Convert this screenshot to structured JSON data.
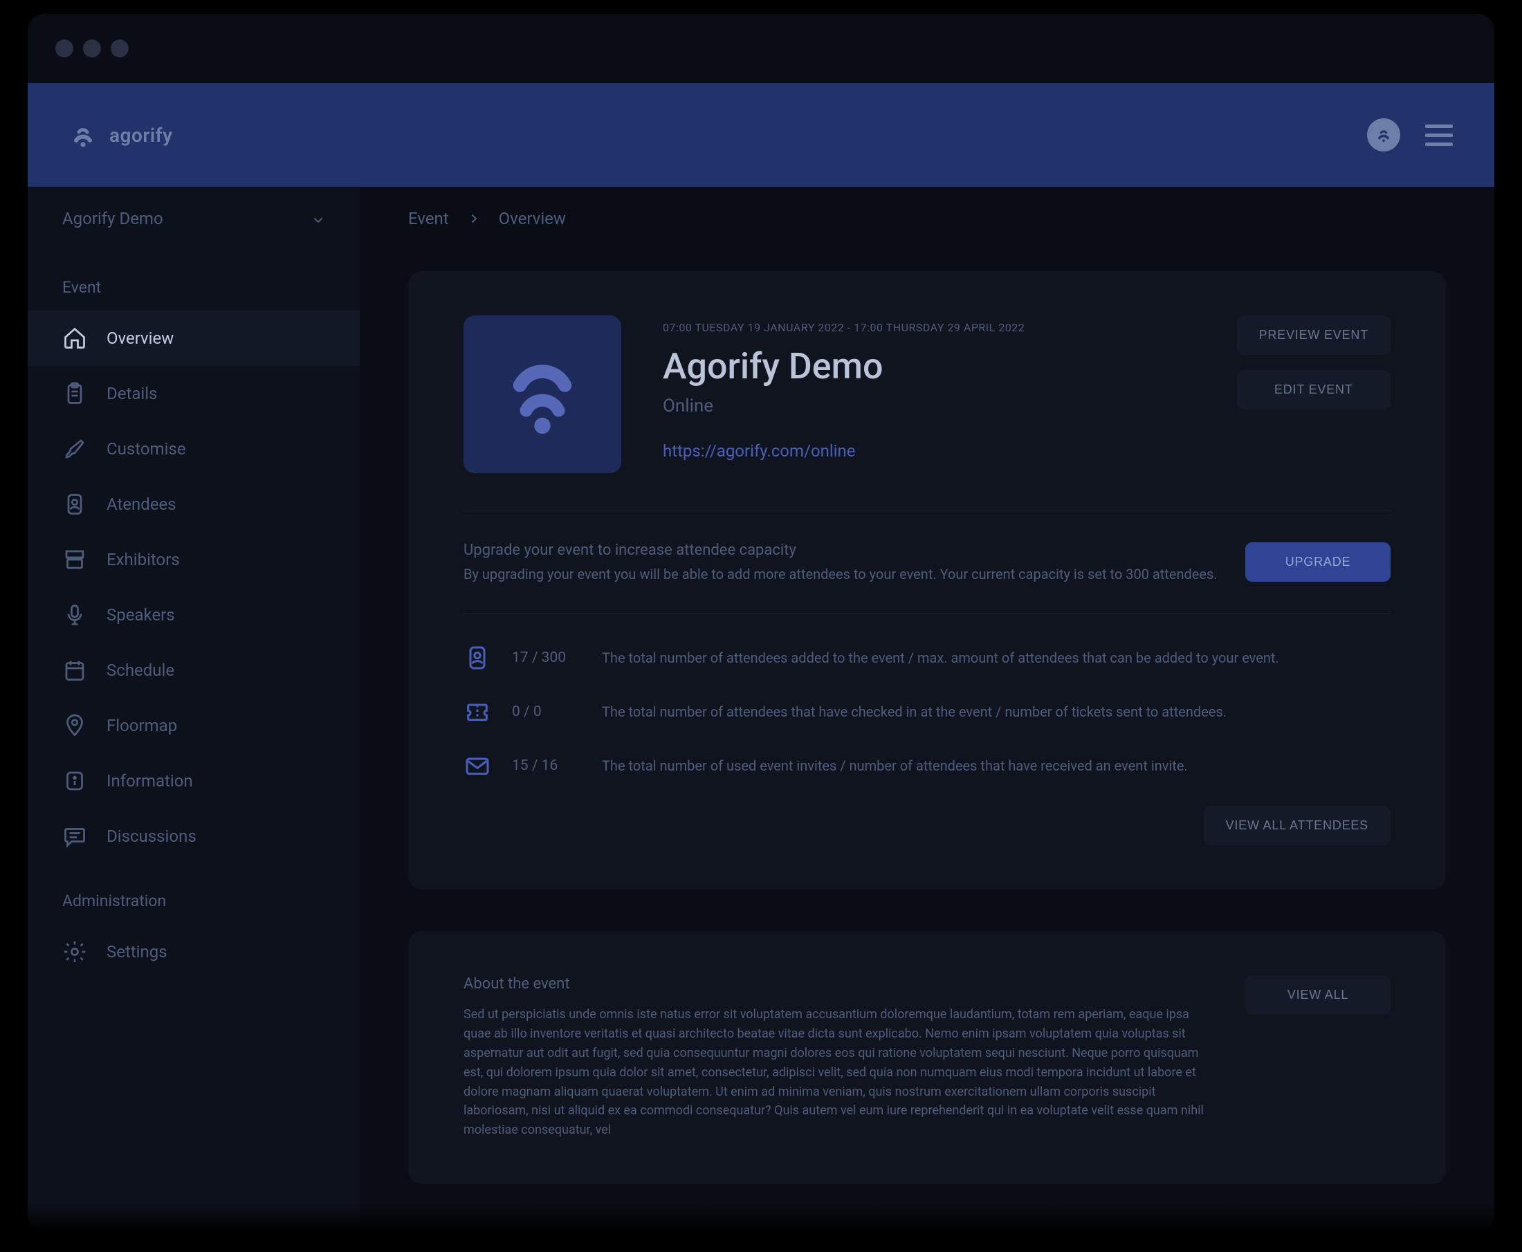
{
  "brand": "agorify",
  "sidebar": {
    "context": "Agorify Demo",
    "sections": [
      {
        "label": "Event",
        "items": [
          {
            "label": "Overview"
          },
          {
            "label": "Details"
          },
          {
            "label": "Customise"
          },
          {
            "label": "Atendees"
          },
          {
            "label": "Exhibitors"
          },
          {
            "label": "Speakers"
          },
          {
            "label": "Schedule"
          },
          {
            "label": "Floormap"
          },
          {
            "label": "Information"
          },
          {
            "label": "Discussions"
          }
        ]
      },
      {
        "label": "Administration",
        "items": [
          {
            "label": "Settings"
          }
        ]
      }
    ]
  },
  "breadcrumb": {
    "root": "Event",
    "current": "Overview"
  },
  "event": {
    "dates": "07:00 TUESDAY 19 JANUARY 2022 - 17:00 THURSDAY 29 APRIL 2022",
    "title": "Agorify Demo",
    "format": "Online",
    "url": "https://agorify.com/online",
    "actions": {
      "preview": "PREVIEW EVENT",
      "edit": "EDIT EVENT"
    }
  },
  "upgrade": {
    "title": "Upgrade your event to increase attendee capacity",
    "desc": "By upgrading your event you will be able to add more attendees to your event. Your current capacity is set to 300 attendees.",
    "button": "UPGRADE"
  },
  "stats": {
    "rows": [
      {
        "value": "17 / 300",
        "desc": "The total number of attendees added to the event / max. amount of attendees that can be added to your event."
      },
      {
        "value": "0 / 0",
        "desc": "The total number of attendees that have checked in at the event / number of tickets sent to attendees."
      },
      {
        "value": "15 / 16",
        "desc": "The total number of used event invites / number of attendees that have received an event invite."
      }
    ],
    "view_all": "VIEW ALL ATTENDEES"
  },
  "about": {
    "title": "About the event",
    "body": "Sed ut perspiciatis unde omnis iste natus error sit voluptatem accusantium doloremque laudantium, totam rem aperiam, eaque ipsa quae ab illo inventore veritatis et quasi architecto beatae vitae dicta sunt explicabo. Nemo enim ipsam voluptatem quia voluptas sit aspernatur aut odit aut fugit, sed quia consequuntur magni dolores eos qui ratione voluptatem sequi nesciunt. Neque porro quisquam est, qui dolorem ipsum quia dolor sit amet, consectetur, adipisci velit, sed quia non numquam eius modi tempora incidunt ut labore et dolore magnam aliquam quaerat voluptatem. Ut enim ad minima veniam, quis nostrum exercitationem ullam corporis suscipit laboriosam, nisi ut aliquid ex ea commodi consequatur? Quis autem vel eum iure reprehenderit qui in ea voluptate velit esse quam nihil molestiae consequatur, vel",
    "view_all": "VIEW ALL"
  }
}
